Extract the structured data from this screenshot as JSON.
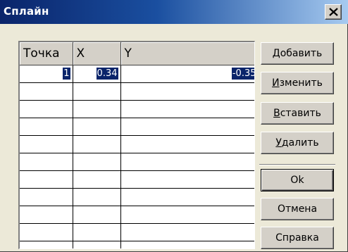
{
  "window": {
    "title": "Сплайн",
    "close_symbol": "close-icon"
  },
  "grid": {
    "columns": [
      "Точка",
      "X",
      "Y"
    ],
    "rows": [
      {
        "point": "1",
        "x": "0.34",
        "y": "-0.35",
        "selected": true
      },
      {
        "point": "",
        "x": "",
        "y": ""
      },
      {
        "point": "",
        "x": "",
        "y": ""
      },
      {
        "point": "",
        "x": "",
        "y": ""
      },
      {
        "point": "",
        "x": "",
        "y": ""
      },
      {
        "point": "",
        "x": "",
        "y": ""
      },
      {
        "point": "",
        "x": "",
        "y": ""
      },
      {
        "point": "",
        "x": "",
        "y": ""
      },
      {
        "point": "",
        "x": "",
        "y": ""
      },
      {
        "point": "",
        "x": "",
        "y": ""
      },
      {
        "point": "",
        "x": "",
        "y": ""
      }
    ]
  },
  "buttons": {
    "add": {
      "accel": "Д",
      "rest": "обавить"
    },
    "edit": {
      "accel": "И",
      "rest": "зменить"
    },
    "insert": {
      "accel": "В",
      "rest": "ставить"
    },
    "delete": {
      "accel": "У",
      "rest": "далить"
    },
    "ok": "Ok",
    "cancel": "Отмена",
    "help": "Справка"
  },
  "colors": {
    "title_bar_start": "#0a246a",
    "title_bar_end": "#a6caf0",
    "selection": "#0a246a",
    "face": "#d4d0c8"
  }
}
